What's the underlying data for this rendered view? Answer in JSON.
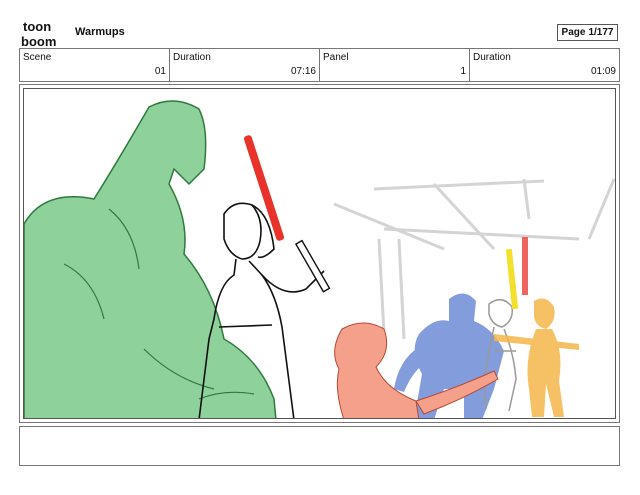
{
  "header": {
    "logo_text_top": "toon",
    "logo_text_bottom": "boom",
    "title": "Warmups",
    "page_label": "Page",
    "page_value": "1/177"
  },
  "meta": [
    {
      "label": "Scene",
      "value": "01"
    },
    {
      "label": "Duration",
      "value": "07:16"
    },
    {
      "label": "Panel",
      "value": "1"
    },
    {
      "label": "Duration",
      "value": "01:09"
    }
  ],
  "colors": {
    "green_character": "#8fd19a",
    "coral_character": "#f4a08a",
    "blue_character": "#5a7bd0",
    "orange_character": "#f5b64a",
    "red_saber": "#e8322a",
    "yellow_saber": "#f2e02a"
  },
  "notes": ""
}
